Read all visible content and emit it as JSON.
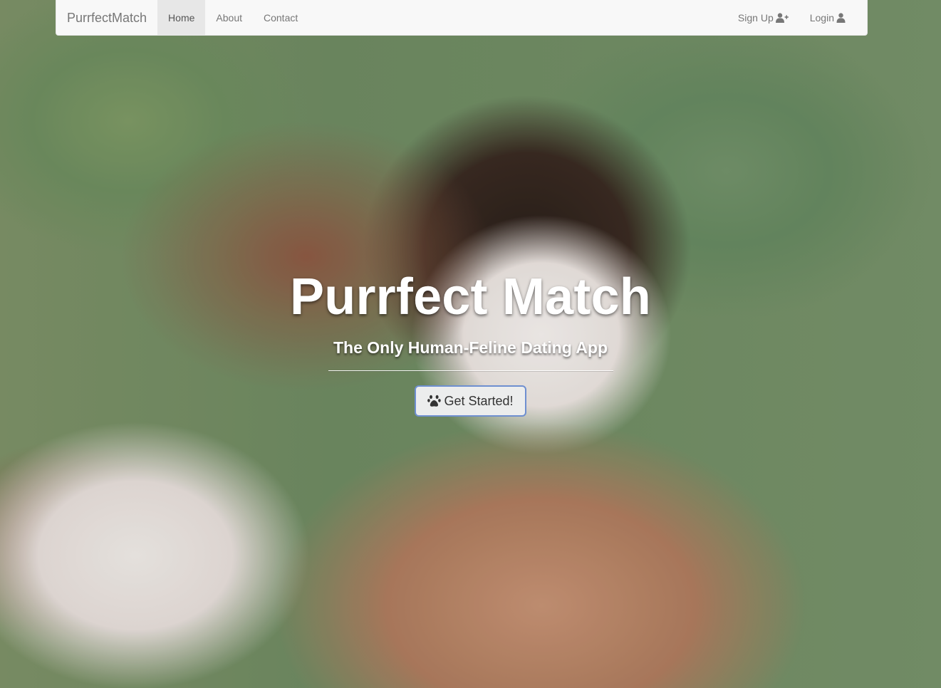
{
  "navbar": {
    "brand": "PurrfectMatch",
    "links": [
      {
        "label": "Home",
        "active": true
      },
      {
        "label": "About",
        "active": false
      },
      {
        "label": "Contact",
        "active": false
      }
    ],
    "right_links": [
      {
        "label": "Sign Up",
        "icon": "user-plus-icon"
      },
      {
        "label": "Login",
        "icon": "user-icon"
      }
    ]
  },
  "hero": {
    "title": "Purrfect Match",
    "subtitle": "The Only Human-Feline Dating App",
    "cta_label": "Get Started!",
    "cta_icon": "paw-icon"
  },
  "colors": {
    "navbar_bg": "#f8f8f8",
    "nav_active_bg": "#e7e7e7",
    "nav_text": "#777777",
    "cta_border": "#6e8fd0",
    "cta_bg": "#eceded"
  }
}
